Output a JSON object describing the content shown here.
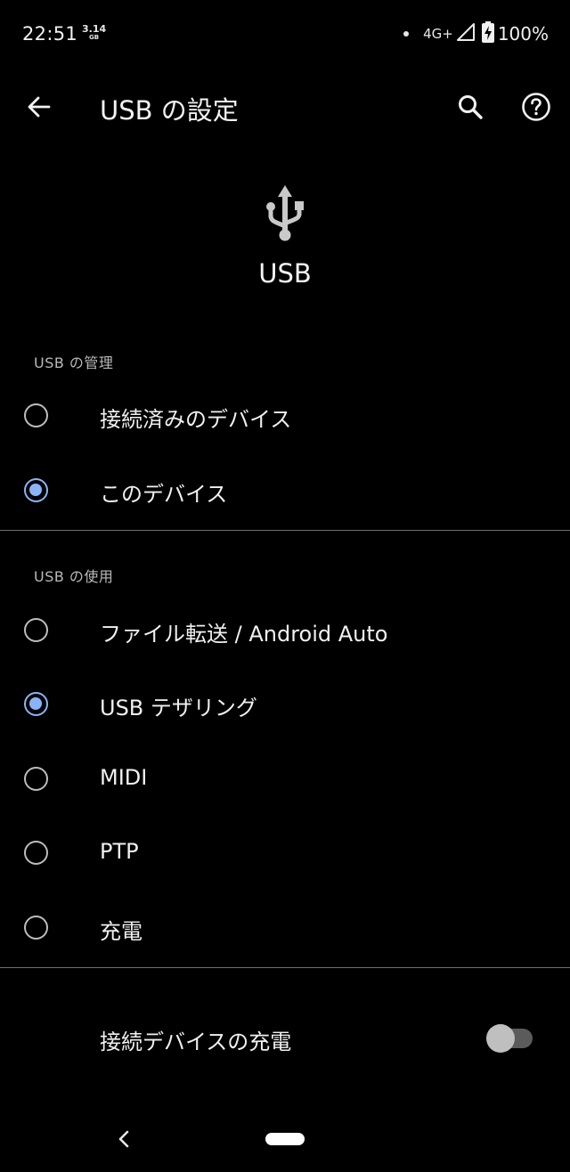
{
  "status_bar": {
    "time": "22:51",
    "memory_value": "3.14",
    "memory_unit": "GB",
    "network_type": "4G+",
    "battery_percent": "100%"
  },
  "app_bar": {
    "title": "USB の設定"
  },
  "hero": {
    "title": "USB"
  },
  "sections": {
    "management": {
      "header": "USB の管理",
      "options": [
        {
          "label": "接続済みのデバイス",
          "selected": false
        },
        {
          "label": "このデバイス",
          "selected": true
        }
      ]
    },
    "usage": {
      "header": "USB の使用",
      "options": [
        {
          "label": "ファイル転送 / Android Auto",
          "selected": false
        },
        {
          "label": "USB テザリング",
          "selected": true
        },
        {
          "label": "MIDI",
          "selected": false
        },
        {
          "label": "PTP",
          "selected": false
        },
        {
          "label": "充電",
          "selected": false
        }
      ]
    }
  },
  "charge_connected": {
    "label": "接続デバイスの充電",
    "enabled": false
  },
  "colors": {
    "background": "#000000",
    "accent": "#8ab4f8",
    "text_primary": "#f0f0f0",
    "text_secondary": "#b9b9b9",
    "divider": "#6e6e6e"
  }
}
